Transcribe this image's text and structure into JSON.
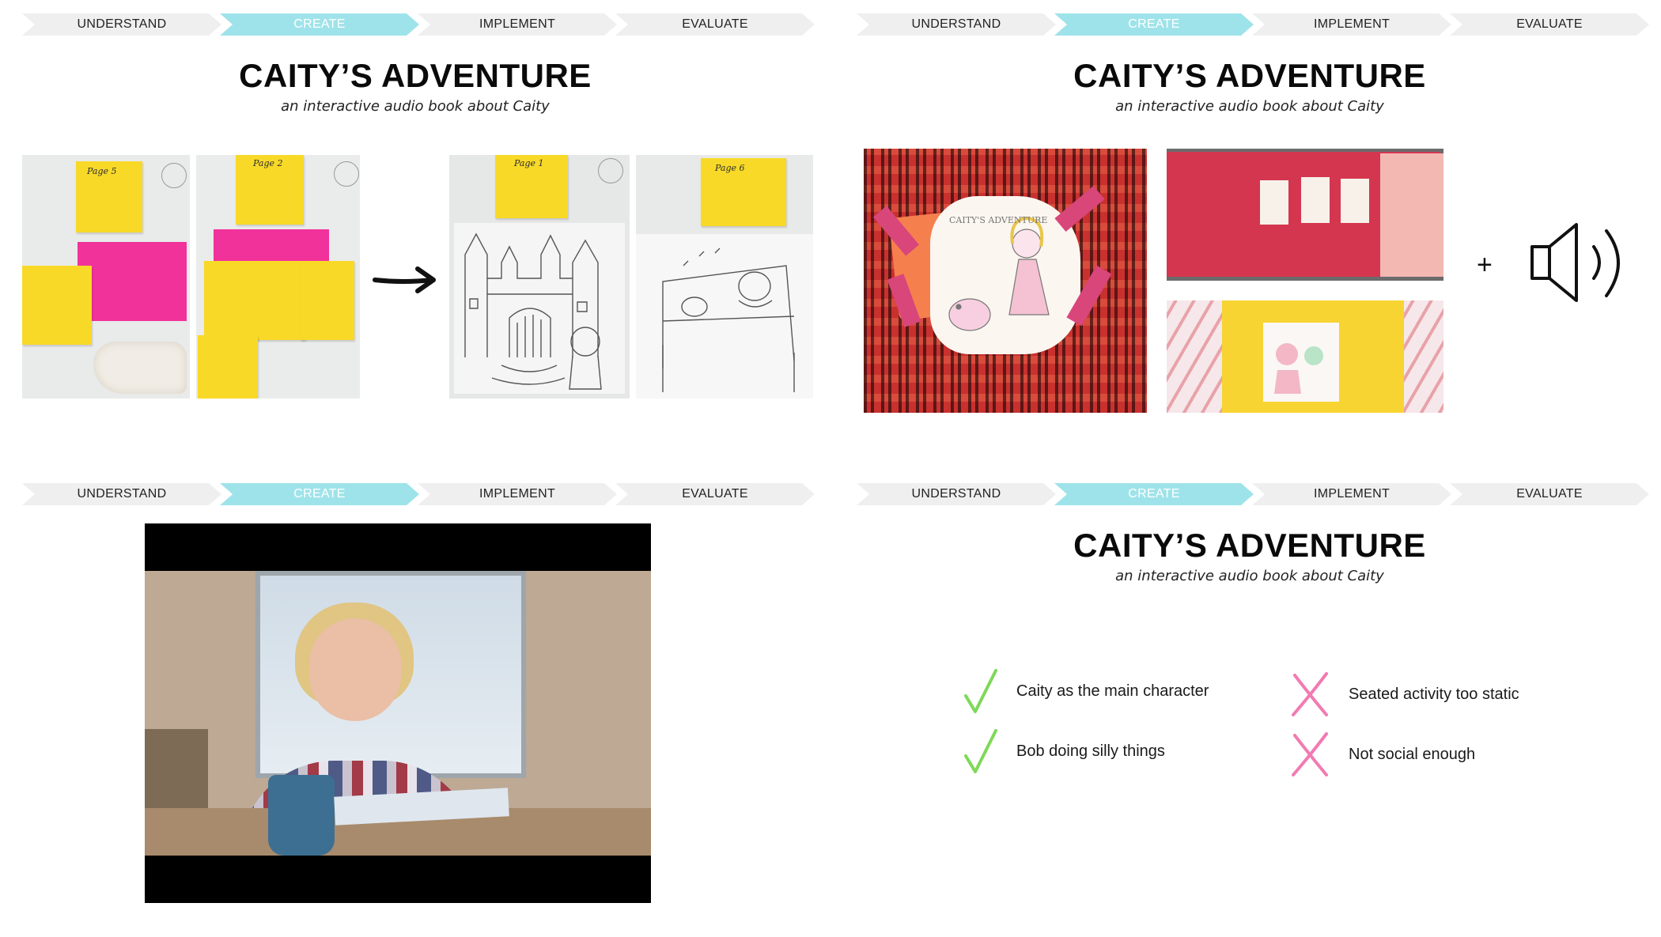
{
  "progress_steps": [
    "UNDERSTAND",
    "CREATE",
    "IMPLEMENT",
    "EVALUATE"
  ],
  "active_step": "CREATE",
  "slide_title": "CAITY’S ADVENTURE",
  "slide_subtitle": "an interactive audio book about Caity",
  "slide1": {
    "sticky_labels": [
      "Page 5",
      "Page 2",
      "Page 1",
      "Page 6"
    ],
    "arrow_icon": "right-arrow-icon"
  },
  "slide2": {
    "plus_symbol": "+",
    "audio_icon": "speaker-icon",
    "book_cover_text": "CAITY'S ADVENTURE"
  },
  "slide4": {
    "positives": [
      "Caity as the main character",
      "Bob doing silly things"
    ],
    "negatives": [
      "Seated activity too static",
      "Not social enough"
    ],
    "check_color": "#7ed957",
    "cross_color": "#f27ab2"
  },
  "colors": {
    "active_step_bg": "#9fe3ea",
    "inactive_step_bg": "#efefef",
    "sticky_yellow": "#f8d928",
    "sticky_pink": "#f0329a"
  }
}
